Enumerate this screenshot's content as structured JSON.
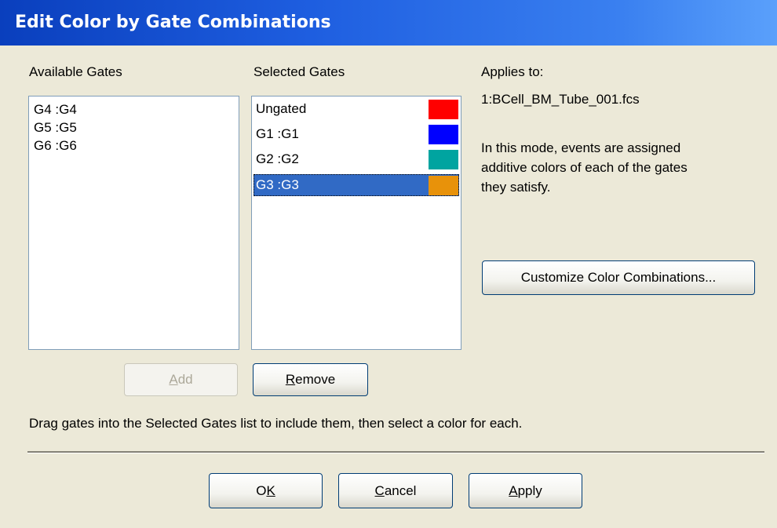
{
  "window": {
    "title": "Edit Color by Gate Combinations"
  },
  "available": {
    "heading": "Available Gates",
    "items": [
      "G4 :G4",
      "G5 :G5",
      "G6 :G6"
    ]
  },
  "selected": {
    "heading": "Selected Gates",
    "items": [
      {
        "label": "Ungated",
        "color": "#ff0000"
      },
      {
        "label": "G1 :G1",
        "color": "#0000ff"
      },
      {
        "label": "G2 :G2",
        "color": "#00a4a0"
      },
      {
        "label": "G3 :G3",
        "color": "#e8920a",
        "selected": true
      }
    ]
  },
  "info": {
    "applies_to_label": "Applies to:",
    "applies_to_file": "1:BCell_BM_Tube_001.fcs",
    "mode_line1": "In this mode, events are assigned",
    "mode_line2": "additive colors of each of the gates",
    "mode_line3": "they satisfy."
  },
  "buttons": {
    "customize": "Customize Color Combinations...",
    "add_u": "A",
    "add_rest": "dd",
    "remove_u": "R",
    "remove_rest": "emove",
    "ok_first": "O",
    "ok_u": "K",
    "cancel_u": "C",
    "cancel_rest": "ancel",
    "apply_u": "A",
    "apply_rest": "pply"
  },
  "hint": "Drag gates into the Selected Gates list to include them, then select a color for each."
}
